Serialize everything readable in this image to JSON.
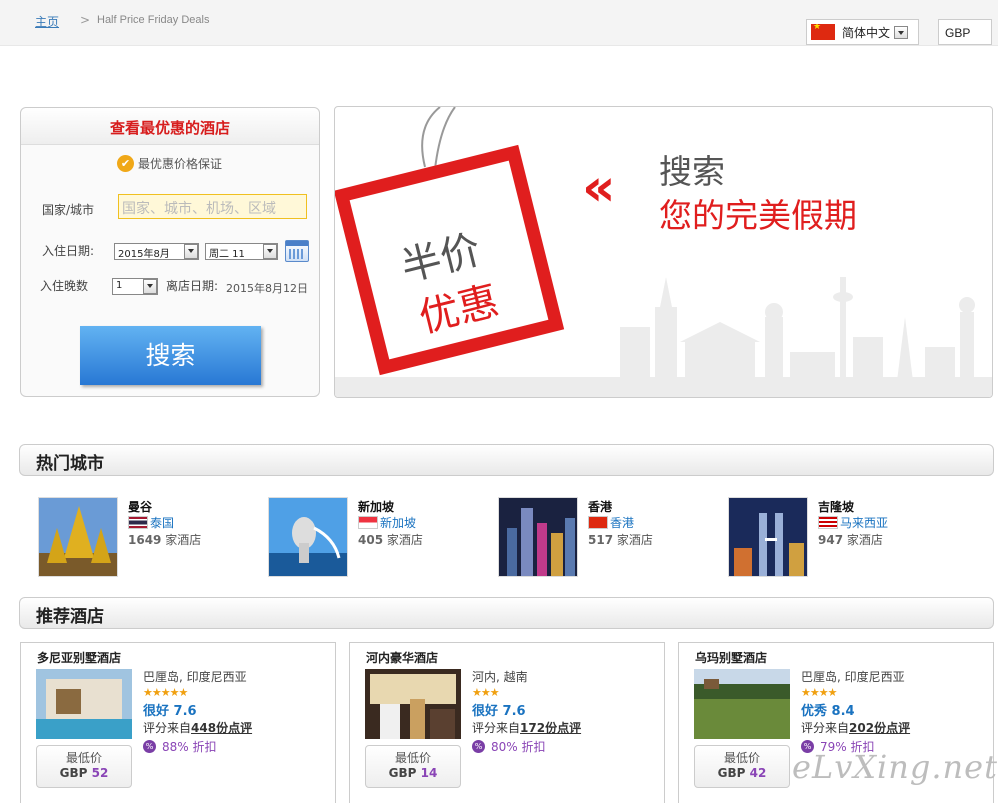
{
  "breadcrumb": {
    "home": "主页",
    "separator": ">",
    "current": "Half Price Friday Deals"
  },
  "header": {
    "language": "简体中文",
    "currency": "GBP"
  },
  "search_box": {
    "title": "查看最优惠的酒店",
    "guarantee": "最优惠价格保证",
    "destination_label": "国家/城市",
    "destination_placeholder": "国家、城市、机场、区域",
    "checkin_label": "入住日期:",
    "checkin_month": "2015年8月",
    "checkin_day": "周二 11",
    "nights_label": "入住晚数",
    "nights_value": "1",
    "checkout_label": "离店日期:",
    "checkout_date": "2015年8月12日",
    "search_button": "搜索"
  },
  "banner": {
    "tag_line1": "半价",
    "tag_line2": "优惠",
    "chevron": "«",
    "headline1": "搜索",
    "headline2": "您的完美假期"
  },
  "popular_cities": {
    "title": "热门城市",
    "unit": "家酒店",
    "items": [
      {
        "name": "曼谷",
        "country": "泰国",
        "count": "1649"
      },
      {
        "name": "新加坡",
        "country": "新加坡",
        "count": "405"
      },
      {
        "name": "香港",
        "country": "香港",
        "count": "517"
      },
      {
        "name": "吉隆坡",
        "country": "马来西亚",
        "count": "947"
      }
    ]
  },
  "recommended": {
    "title": "推荐酒店",
    "review_prefix": "评分来自",
    "price_label": "最低价",
    "discount_suffix": "折扣",
    "hotels": [
      {
        "name": "多尼亚别墅酒店",
        "location": "巴厘岛, 印度尼西亚",
        "stars": "★★★★★",
        "score": "很好 7.6",
        "reviews": "448份点评",
        "discount": "88%",
        "currency": "GBP",
        "price": "52"
      },
      {
        "name": "河内豪华酒店",
        "location": "河内, 越南",
        "stars": "★★★",
        "score": "很好 7.6",
        "reviews": "172份点评",
        "discount": "80%",
        "currency": "GBP",
        "price": "14"
      },
      {
        "name": "乌玛别墅酒店",
        "location": "巴厘岛, 印度尼西亚",
        "stars": "★★★★",
        "score": "优秀 8.4",
        "reviews": "202份点评",
        "discount": "79%",
        "currency": "GBP",
        "price": "42"
      }
    ]
  },
  "watermark": "eLvXing.net"
}
